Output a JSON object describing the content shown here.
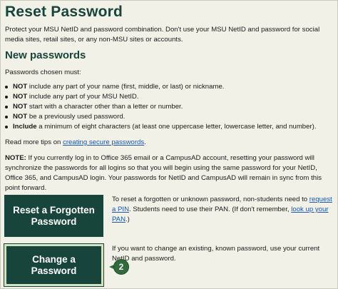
{
  "page": {
    "title": "Reset Password",
    "intro": "Protect your MSU NetID and password combination. Don't use your MSU NetID and password for social media sites, retail sites, or any non-MSU sites or accounts.",
    "section_heading": "New passwords",
    "rules_intro": "Passwords chosen must:",
    "rules": [
      {
        "bold": "NOT",
        "text": " include any part of your name (first, middle, or last) or nickname."
      },
      {
        "bold": "NOT",
        "text": " include any part of your MSU NetID."
      },
      {
        "bold": "NOT",
        "text": " start with a character other than a letter or number."
      },
      {
        "bold": "NOT",
        "text": " be a previously used password."
      },
      {
        "bold": "Include",
        "text": " a minimum of eight characters (at least one uppercase letter, lowercase letter, and number)."
      }
    ],
    "tips_prefix": "Read more tips on ",
    "tips_link": "creating secure passwords",
    "tips_suffix": ".",
    "note_label": "NOTE:",
    "note_text": " If you currently log in to Office 365 email or a CampusAD account, resetting your password will synchronize the passwords for all logins so that you will begin using the same password for your NetID, Office 365, and CampusAD login. Your passwords for NetID and CampusAD will remain in sync from this point forward."
  },
  "forgotten": {
    "button_label": "Reset a Forgotten Password",
    "desc_prefix": "To reset a forgotten or unknown password, non-students need to ",
    "desc_link1": "request a PIN",
    "desc_middle": ". Students need to use their PAN. (If don't remember, ",
    "desc_link2": "look up your PAN",
    "desc_suffix": ".)"
  },
  "change": {
    "button_label": "Change a Password",
    "desc": "If you want to change an existing, known password, use your current NetID and password."
  },
  "callout": {
    "number": "2"
  },
  "colors": {
    "msu_green": "#18453b",
    "background": "#f1f1e7",
    "link": "#1a56b8",
    "callout": "#2f6b3b"
  }
}
